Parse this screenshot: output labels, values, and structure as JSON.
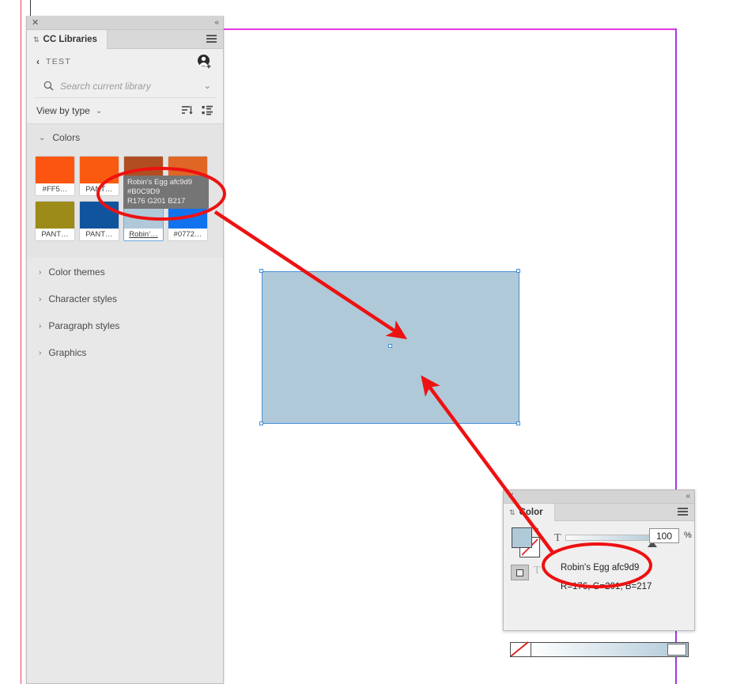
{
  "canvas": {
    "rectangle_fill": "#AFC9D9",
    "selection_color": "#4A90D9",
    "page_guide_color": "#E23AE2"
  },
  "cc_libraries_panel": {
    "close_glyph": "✕",
    "collapse_glyph": "«",
    "tab_label": "CC Libraries",
    "tab_drag_glyph": "⇅",
    "menu_icon_name": "hamburger-menu-icon",
    "breadcrumb": {
      "back_glyph": "‹",
      "library_name": "TEST",
      "avatar_icon_name": "add-collaborator-icon"
    },
    "search": {
      "placeholder": "Search current library",
      "icon_name": "search-icon",
      "caret_glyph": "⌄"
    },
    "view_row": {
      "label": "View by type",
      "caret_glyph": "⌄",
      "sort_icon_name": "sort-descending-icon",
      "list_view_icon_name": "list-view-icon"
    },
    "sections": [
      {
        "label": "Colors",
        "expanded": true,
        "chevron": "⌄"
      },
      {
        "label": "Color themes",
        "expanded": false,
        "chevron": "›"
      },
      {
        "label": "Character styles",
        "expanded": false,
        "chevron": "›"
      },
      {
        "label": "Paragraph styles",
        "expanded": false,
        "chevron": "›"
      },
      {
        "label": "Graphics",
        "expanded": false,
        "chevron": "›"
      }
    ],
    "swatches": [
      {
        "caption": "#FF5…",
        "color": "#FC5512",
        "selected": false
      },
      {
        "caption": "PANT…",
        "color": "#F95A0F",
        "selected": false
      },
      {
        "caption": "",
        "color": "#B04E21",
        "selected": false
      },
      {
        "caption": "",
        "color": "#E06626",
        "selected": false
      },
      {
        "caption": "PANT…",
        "color": "#9C8B18",
        "selected": false
      },
      {
        "caption": "PANT…",
        "color": "#11549E",
        "selected": false
      },
      {
        "caption": "Robin’…",
        "color": "#AFC9D9",
        "selected": true
      },
      {
        "caption": "#0772…",
        "color": "#1172EE",
        "selected": false
      }
    ],
    "tooltip": {
      "line1": "Robin's Egg afc9d9",
      "line2": "#B0C9D9",
      "line3": "R176 G201 B217"
    }
  },
  "color_panel": {
    "close_glyph": "✕",
    "collapse_glyph": "«",
    "tab_label": "Color",
    "tab_drag_glyph": "⇅",
    "menu_icon_name": "hamburger-menu-icon",
    "fill_color": "#AFC9D9",
    "stroke_color": "none",
    "swap_glyph": "↰",
    "format_toggle_icon_name": "fill-proxy-icon",
    "type_glyph_1": "T",
    "type_glyph_2": "T",
    "tint_value": "100",
    "tint_unit": "%",
    "swatch_name": "Robin's Egg afc9d9",
    "swatch_rgb": "R=176, G=201, B=217",
    "ramp_none_label": "none-swatch",
    "ramp_gradient_to": "#AFC9D9"
  },
  "annotations": {
    "ellipse_color": "#EE1111",
    "arrow_color": "#EE1111",
    "ellipse_count": 2,
    "arrow_count": 2
  }
}
